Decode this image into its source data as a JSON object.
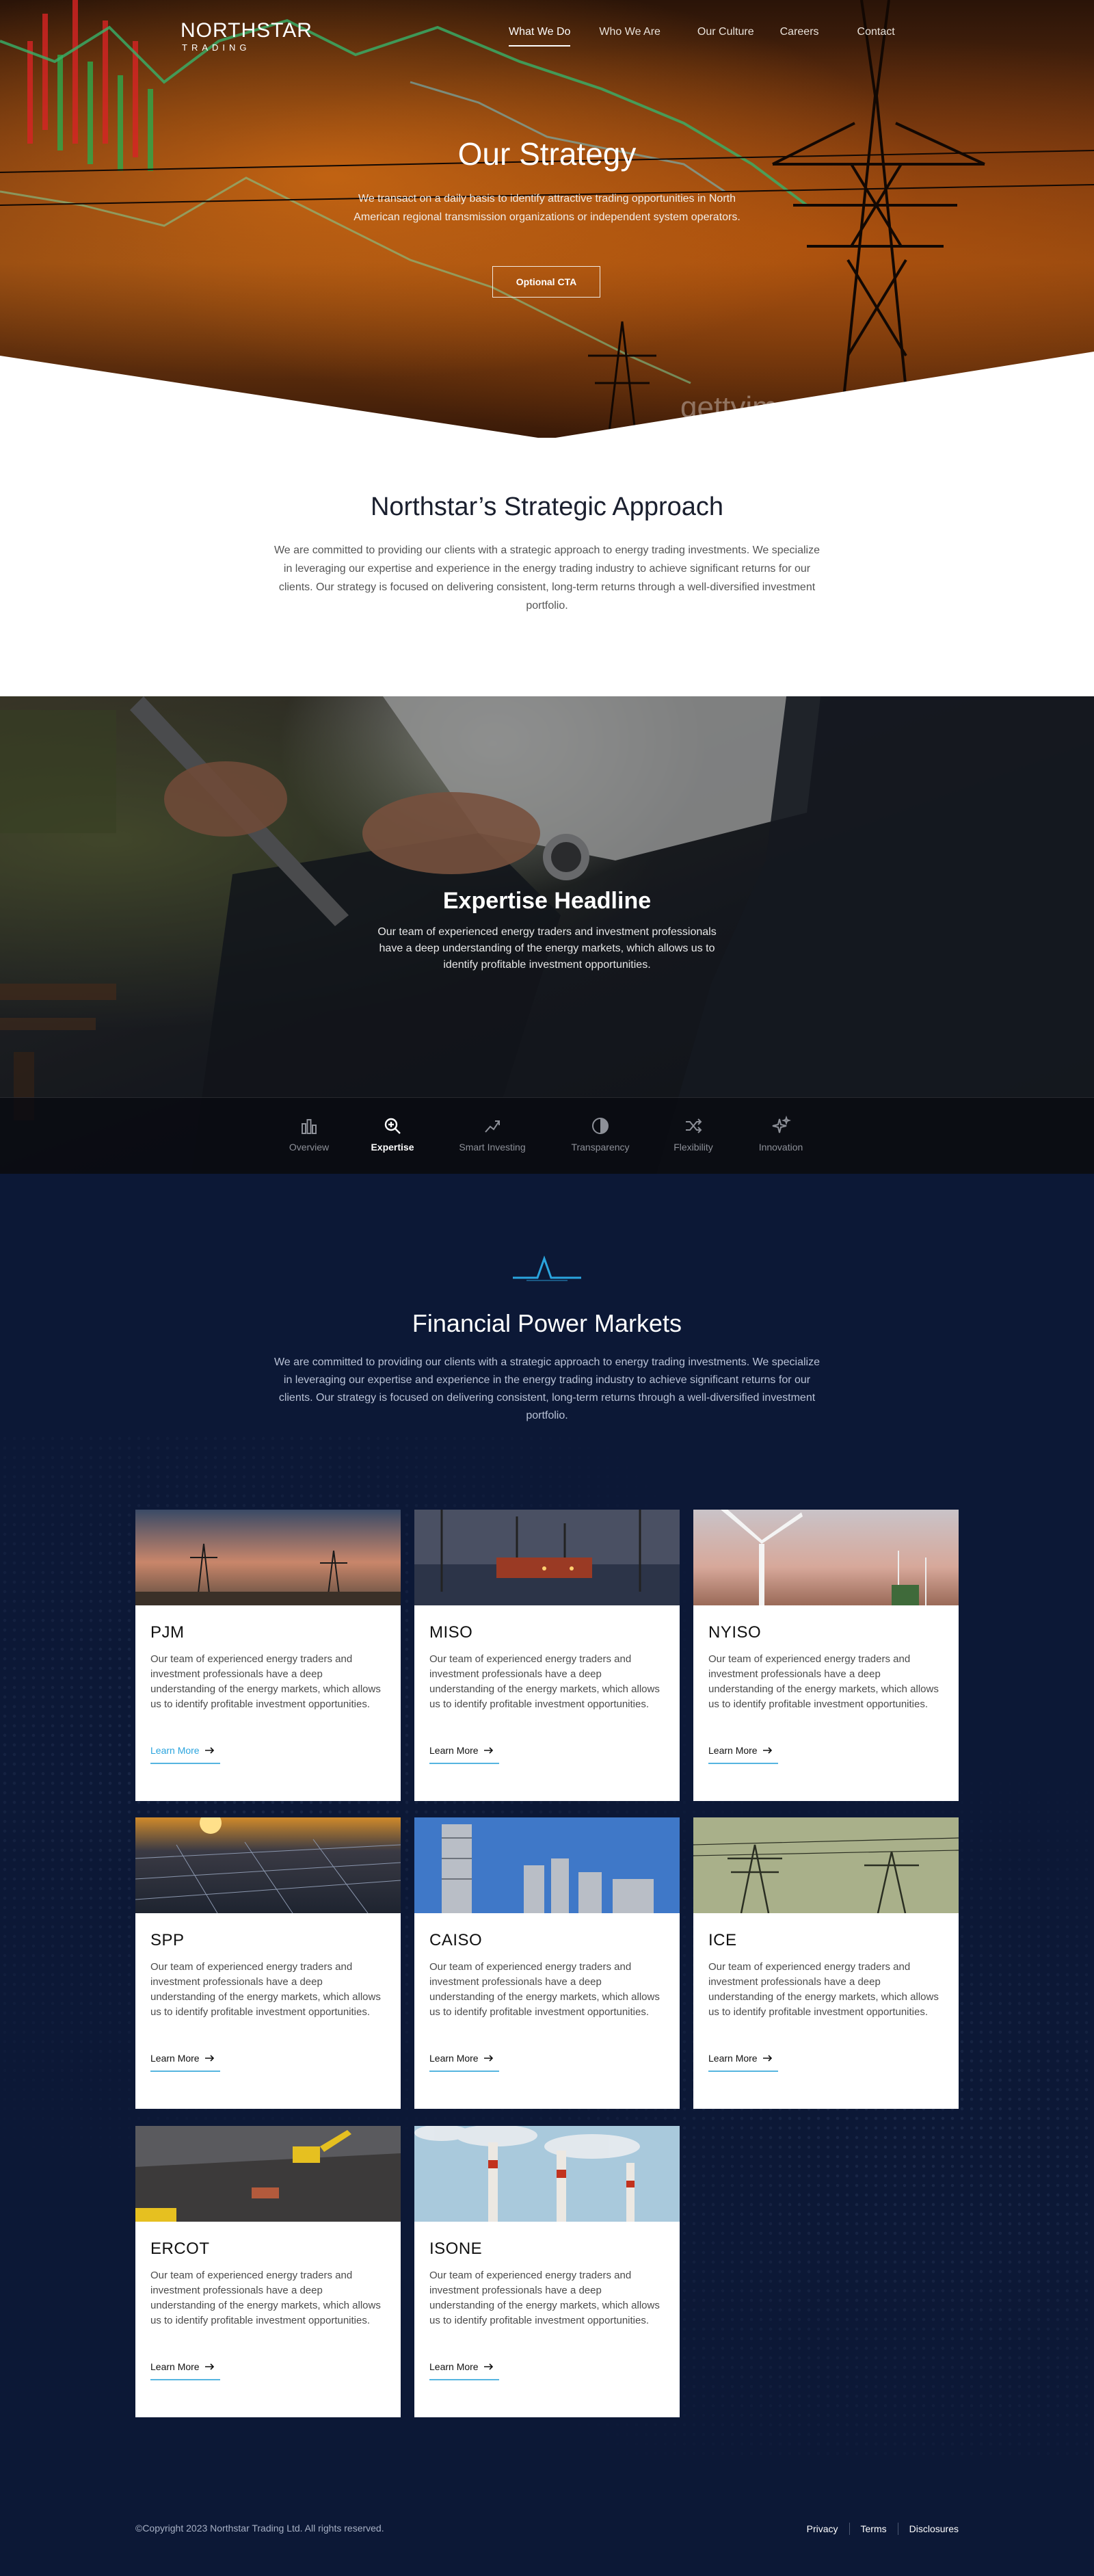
{
  "brand": {
    "name": "NORTHSTAR",
    "sub": "TRADING",
    "accent": "#2aa4de",
    "navy": "#0c1836"
  },
  "nav": {
    "items": [
      {
        "label": "What We Do",
        "active": true
      },
      {
        "label": "Who We Are",
        "active": false
      },
      {
        "label": "Our Culture",
        "active": false
      },
      {
        "label": "Careers",
        "active": false
      },
      {
        "label": "Contact",
        "active": false
      }
    ]
  },
  "hero": {
    "title": "Our Strategy",
    "body": "We transact on a daily basis to identify attractive trading opportunities in North American regional transmission organizations or independent system operators.",
    "cta": "Optional CTA",
    "watermark": "gettyimag"
  },
  "approach": {
    "title": "Northstar’s Strategic Approach",
    "body": "We are committed to providing our clients with a strategic approach to energy trading investments. We specialize in leveraging our expertise and experience in the energy trading industry to achieve significant returns for our clients. Our strategy is focused on delivering consistent, long-term returns through a well-diversified investment portfolio."
  },
  "expertise": {
    "title": "Expertise Headline",
    "body": "Our team of experienced energy traders and investment professionals have a deep understanding of the energy markets, which allows us to identify profitable investment opportunities.",
    "tabs": [
      {
        "label": "Overview",
        "icon": "bar-chart-icon",
        "active": false
      },
      {
        "label": "Expertise",
        "icon": "magnify-icon",
        "active": true
      },
      {
        "label": "Smart Investing",
        "icon": "trend-icon",
        "active": false
      },
      {
        "label": "Transparency",
        "icon": "half-circle-icon",
        "active": false
      },
      {
        "label": "Flexibility",
        "icon": "shuffle-icon",
        "active": false
      },
      {
        "label": "Innovation",
        "icon": "sparkle-icon",
        "active": false
      }
    ]
  },
  "markets": {
    "title": "Financial Power Markets",
    "body": "We are committed to providing our clients with a strategic approach to energy trading investments. We specialize in leveraging our expertise and experience in the energy trading industry to achieve significant returns for our clients. Our strategy is focused on delivering consistent, long-term returns through a well-diversified investment portfolio.",
    "cards": [
      {
        "name": "PJM",
        "body": "Our team of experienced energy traders and investment professionals have a deep understanding of the energy markets, which allows us to identify profitable investment opportunities.",
        "link": "Learn More",
        "photo": "sunset-towers"
      },
      {
        "name": "MISO",
        "body": "Our team of experienced energy traders and investment professionals have a deep understanding of the energy markets, which allows us to identify profitable investment opportunities.",
        "link": "Learn More",
        "photo": "oil-rig"
      },
      {
        "name": "NYISO",
        "body": "Our team of experienced energy traders and investment professionals have a deep understanding of the energy markets, which allows us to identify profitable investment opportunities.",
        "link": "Learn More",
        "photo": "wind-turbine"
      },
      {
        "name": "SPP",
        "body": "Our team of experienced energy traders and investment professionals have a deep understanding of the energy markets, which allows us to identify profitable investment opportunities.",
        "link": "Learn More",
        "photo": "solar-panels"
      },
      {
        "name": "CAISO",
        "body": "Our team of experienced energy traders and investment professionals have a deep understanding of the energy markets, which allows us to identify profitable investment opportunities.",
        "link": "Learn More",
        "photo": "power-plant"
      },
      {
        "name": "ICE",
        "body": "Our team of experienced energy traders and investment professionals have a deep understanding of the energy markets, which allows us to identify profitable investment opportunities.",
        "link": "Learn More",
        "photo": "pylons"
      },
      {
        "name": "ERCOT",
        "body": "Our team of experienced energy traders and investment professionals have a deep understanding of the energy markets, which allows us to identify profitable investment opportunities.",
        "link": "Learn More",
        "photo": "mining"
      },
      {
        "name": "ISONE",
        "body": "Our team of experienced energy traders and investment professionals have a deep understanding of the energy markets, which allows us to identify profitable investment opportunities.",
        "link": "Learn More",
        "photo": "smokestacks"
      }
    ]
  },
  "footer": {
    "copyright": "©Copyright 2023 Northstar Trading Ltd. All rights reserved.",
    "links": [
      "Privacy",
      "Terms",
      "Disclosures"
    ]
  }
}
